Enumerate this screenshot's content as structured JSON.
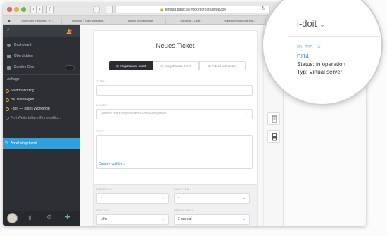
{
  "browser": {
    "url": "tomrad.panic.at/#ticket/create/id/88284",
    "tabs": [
      "dont panic Helpdesk · R...",
      "Wartung + Patchungsant...",
      "Failed to open page",
      "Add-ons – i-doit",
      "Kategorien und Attribut...",
      "CMDB..."
    ]
  },
  "sidebar": {
    "items": [
      {
        "label": "Dashboard"
      },
      {
        "label": "Übersichten"
      },
      {
        "label": "Kunden Chat"
      }
    ],
    "section_label": "Anfrage",
    "orgs": [
      {
        "label": "Stadtmarketing"
      },
      {
        "label": "div. Unterlagen"
      },
      {
        "label": "i-doit — Tages Workshop"
      },
      {
        "label": "Fort Weiterbildung/Fortsendlig..."
      }
    ],
    "active_item": "Anruf eingehend"
  },
  "form": {
    "title": "Neues Ticket",
    "segments": [
      "Eingehender Anruf",
      "Ausgehender Anruf",
      "E-Mail versenden"
    ],
    "title_label": "TITEL *",
    "customer_label": "KUNDE *",
    "customer_placeholder": "Person oder Organisation/Firma eingeben",
    "text_label": "TEXT *",
    "attach_link": "Dateien wählen...",
    "group_label": "GRUPPE *",
    "group_value": "-",
    "owner_label": "BESITZER",
    "owner_value": "-",
    "status_label": "STATUS *",
    "status_value": "offen",
    "priority_label": "PRIORITÄT *",
    "priority_value": "2 normal"
  },
  "side_panel": {
    "title": "i-doit",
    "id_label": "ID: 655",
    "object_link": "CI14",
    "status_line": "Status: in operation",
    "type_line": "Typ: Virtual server"
  },
  "colors": {
    "sidebar_bg": "#2c3035",
    "accent": "#2ea0dd",
    "org_dot": "#f0a030",
    "link": "#2e8ed6"
  }
}
